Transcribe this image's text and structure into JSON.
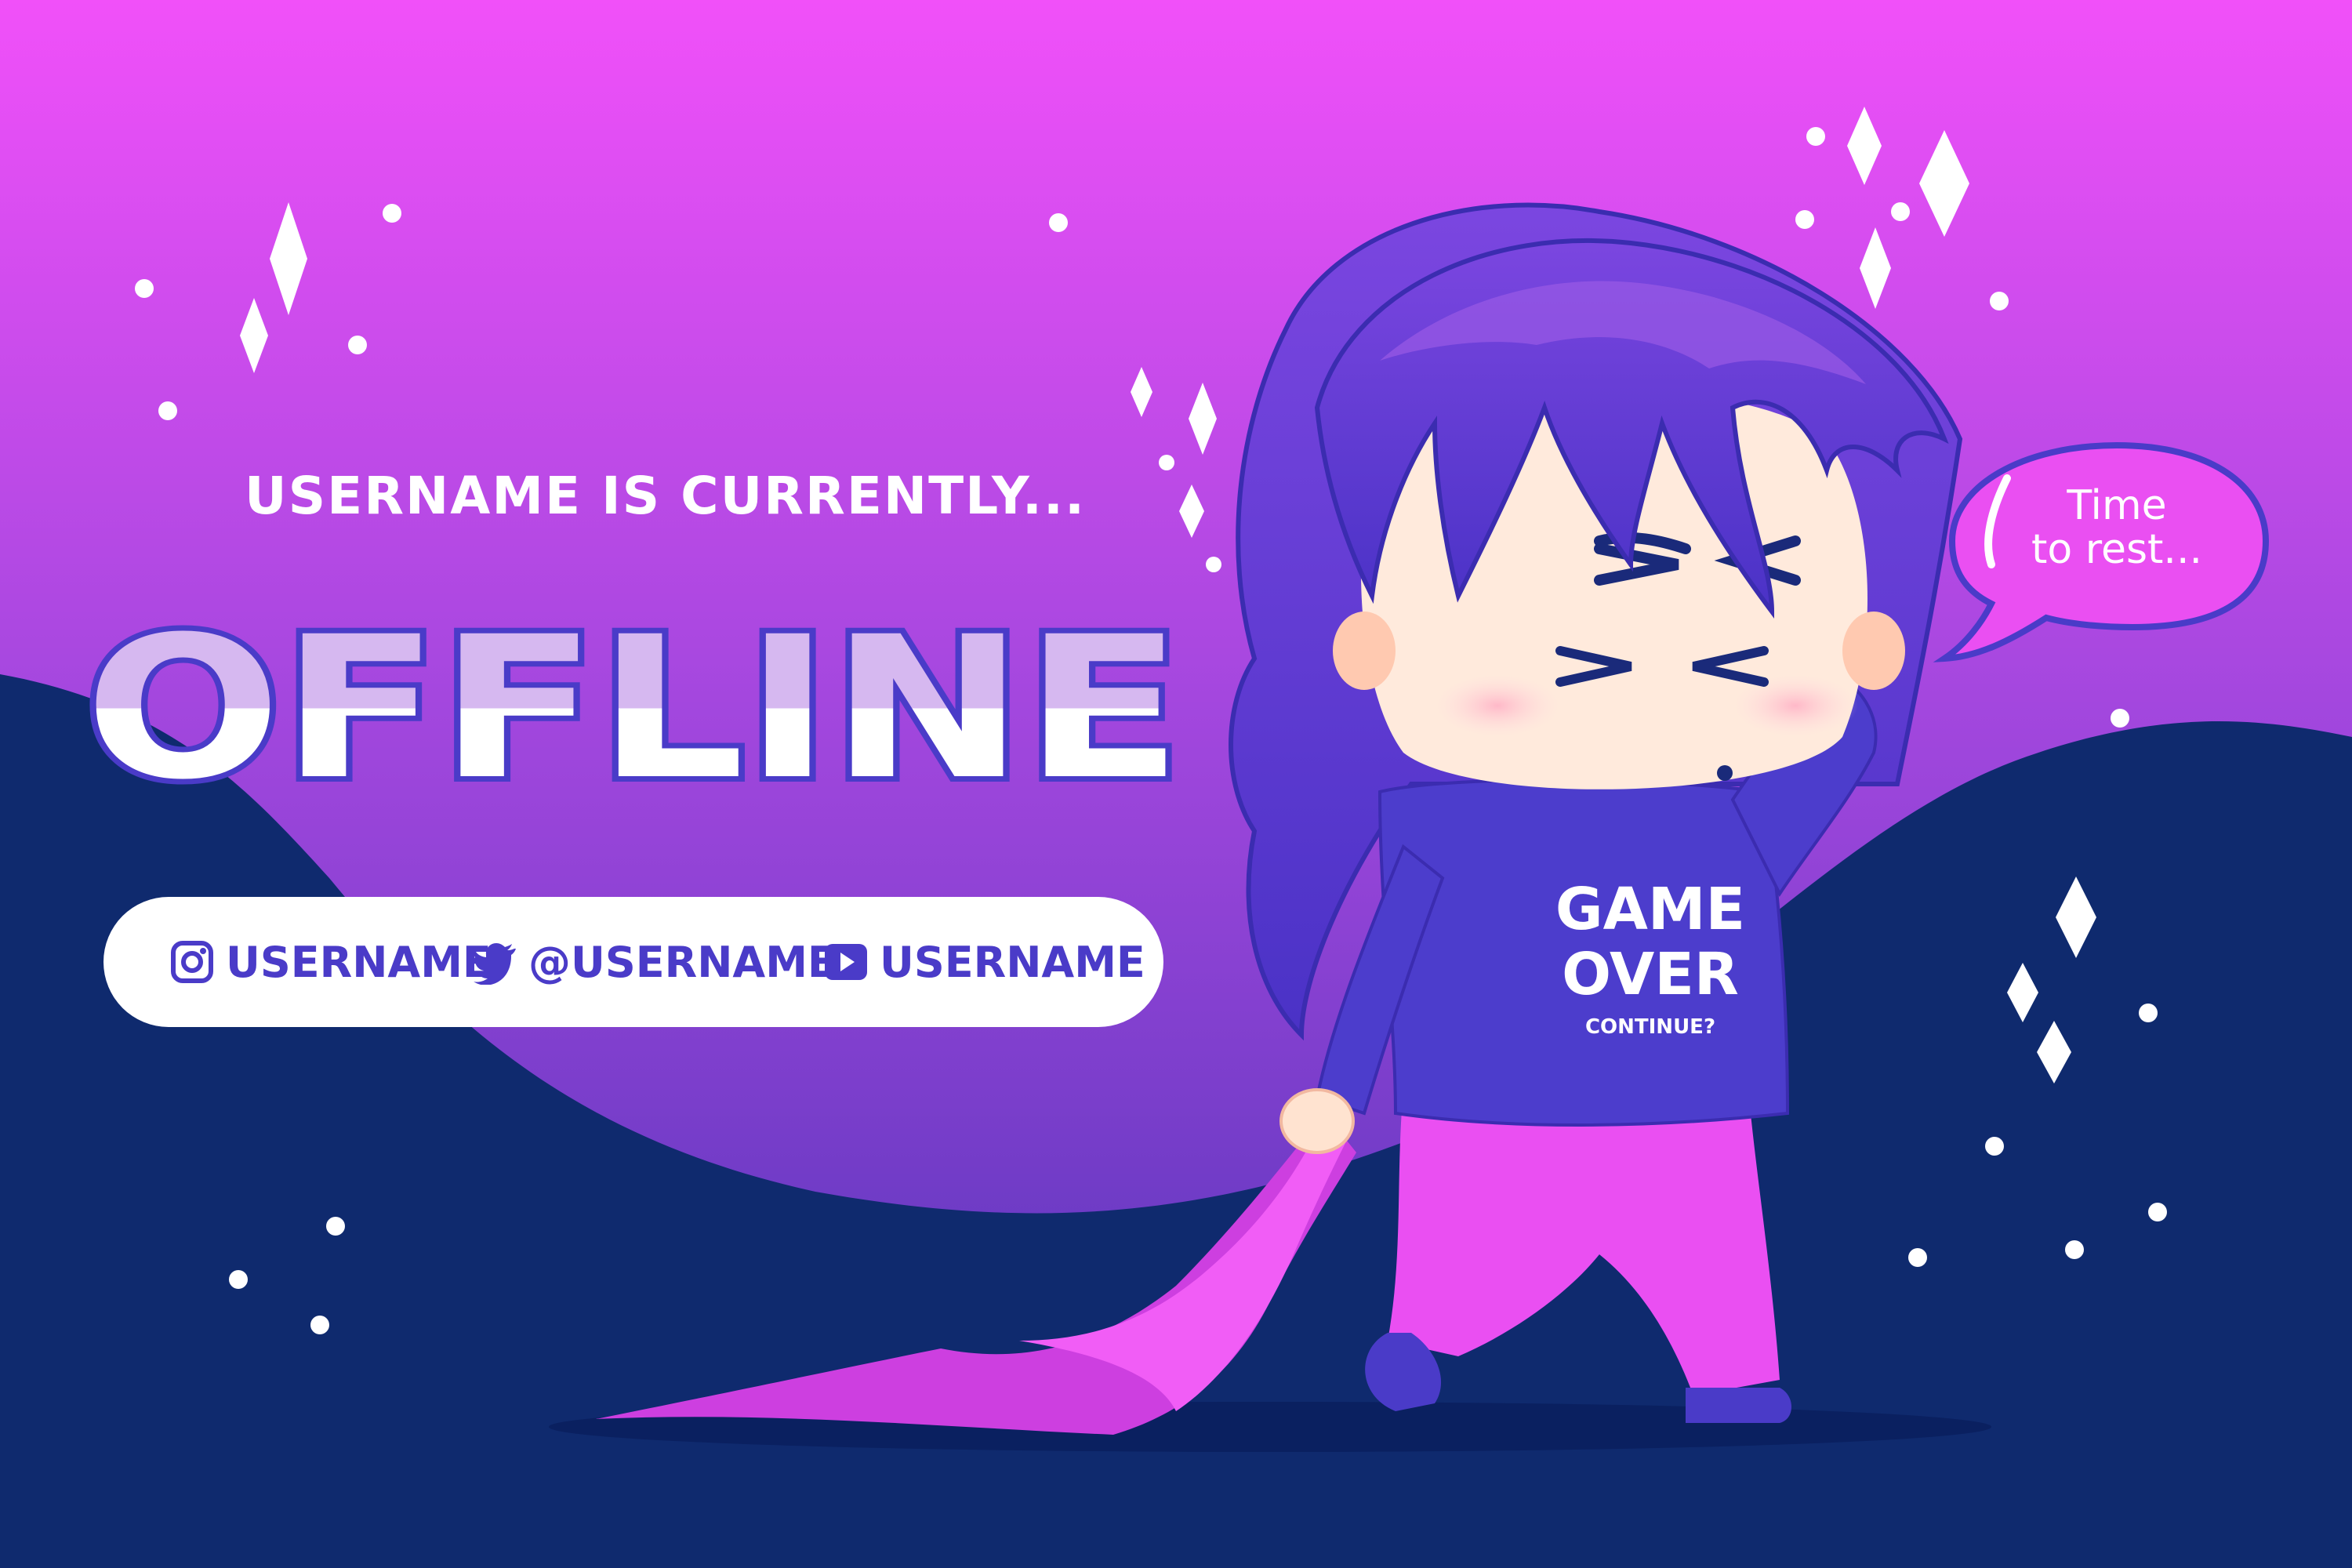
{
  "banner": {
    "subtitle": "USERNAME IS CURRENTLY...",
    "status_word": "OFFLINE",
    "speech_bubble": {
      "line1": "Time",
      "line2": "to rest..."
    },
    "shirt": {
      "line1": "GAME",
      "line2": "OVER",
      "line3": "CONTINUE?"
    }
  },
  "socials": [
    {
      "icon": "instagram-icon",
      "label": "USERNAME"
    },
    {
      "icon": "twitter-icon",
      "label": "@USERNAME"
    },
    {
      "icon": "youtube-icon",
      "label": "USERNAME"
    }
  ],
  "colors": {
    "bg_top": "#f04ef8",
    "bg_mid": "#9a3fd6",
    "bg_wave": "#0f2a6e",
    "accent_purple": "#4a3bc8",
    "pink": "#ea4ff2",
    "text_white": "#ffffff"
  }
}
